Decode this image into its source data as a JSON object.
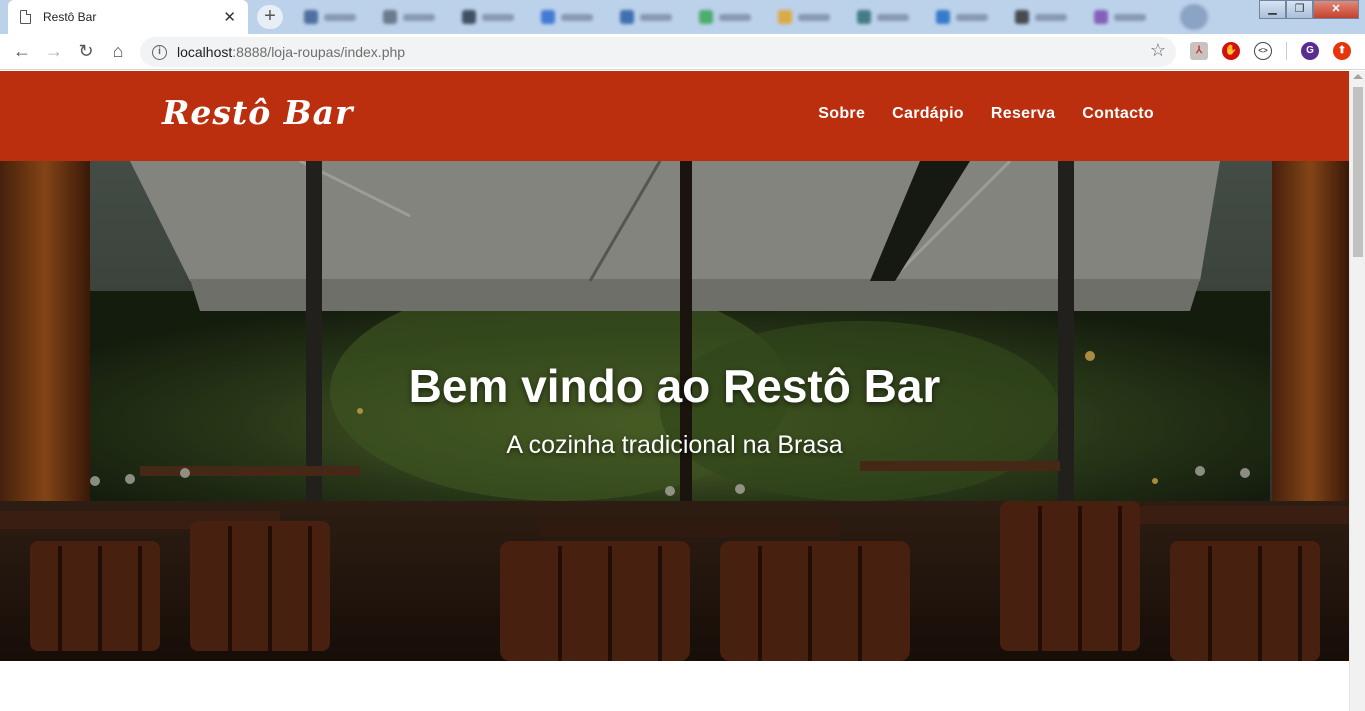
{
  "browser": {
    "tab_title": "Restô Bar",
    "tab_close": "✕",
    "new_tab": "+",
    "url_host": "localhost",
    "url_path": ":8888/loja-roupas/index.php",
    "profile_initial": "G",
    "window_controls": {
      "minimize": "▁",
      "maximize": "❐",
      "close": "✕"
    }
  },
  "colors": {
    "header_bg": "#bb2e0e",
    "tab_strip": "#bcd1ea"
  },
  "site": {
    "brand": "Restô Bar",
    "nav": [
      "Sobre",
      "Cardápio",
      "Reserva",
      "Contacto"
    ],
    "hero": {
      "title": "Bem vindo ao Restô Bar",
      "subtitle": "A cozinha tradicional na Brasa"
    }
  },
  "icons": {
    "back": "back-arrow-icon",
    "forward": "forward-arrow-icon",
    "reload": "reload-icon",
    "home": "home-icon",
    "info": "info-icon",
    "star": "star-icon"
  }
}
